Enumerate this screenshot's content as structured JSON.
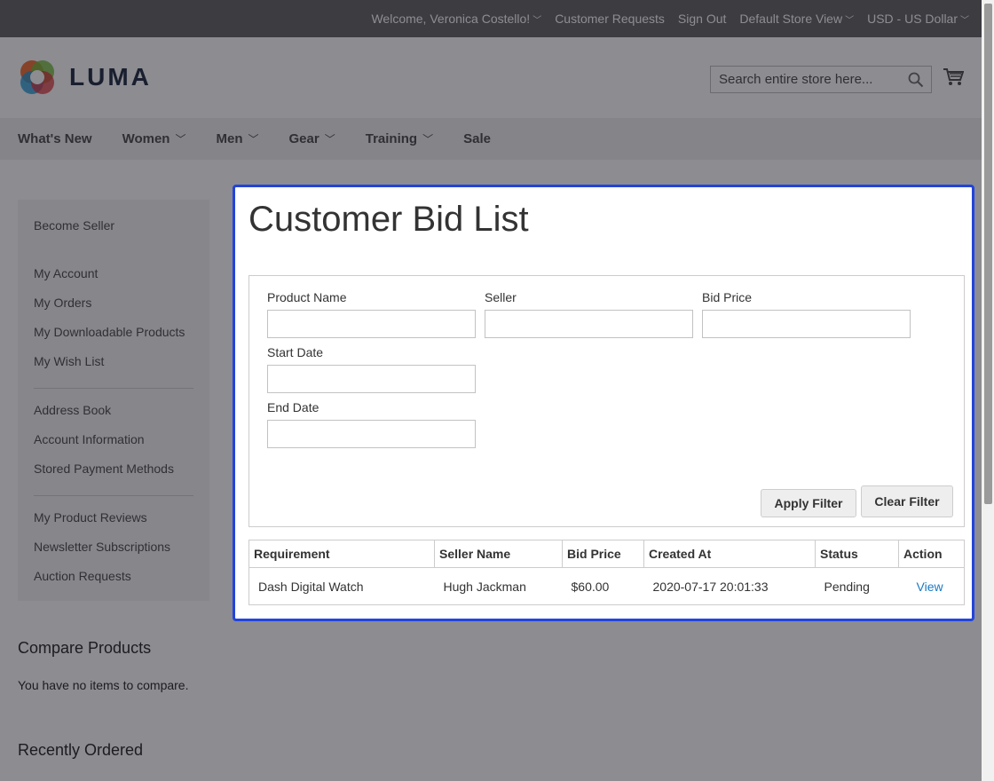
{
  "topbar": {
    "welcome": "Welcome, Veronica Costello!",
    "customer_requests": "Customer Requests",
    "sign_out": "Sign Out",
    "store_view": "Default Store View",
    "currency": "USD - US Dollar"
  },
  "header": {
    "logo_text": "LUMA",
    "search_placeholder": "Search entire store here..."
  },
  "nav": {
    "items": [
      {
        "label": "What's New",
        "has_dropdown": false
      },
      {
        "label": "Women",
        "has_dropdown": true
      },
      {
        "label": "Men",
        "has_dropdown": true
      },
      {
        "label": "Gear",
        "has_dropdown": true
      },
      {
        "label": "Training",
        "has_dropdown": true
      },
      {
        "label": "Sale",
        "has_dropdown": false
      }
    ]
  },
  "sidebar": {
    "groups": [
      [
        "Become Seller"
      ],
      [
        "My Account",
        "My Orders",
        "My Downloadable Products",
        "My Wish List"
      ],
      [
        "Address Book",
        "Account Information",
        "Stored Payment Methods"
      ],
      [
        "My Product Reviews",
        "Newsletter Subscriptions",
        "Auction Requests"
      ]
    ]
  },
  "compare": {
    "title": "Compare Products",
    "empty_text": "You have no items to compare."
  },
  "recent": {
    "title": "Recently Ordered"
  },
  "main": {
    "title": "Customer Bid List",
    "filters": {
      "product_name_label": "Product Name",
      "product_name_value": "",
      "seller_label": "Seller",
      "seller_value": "",
      "bid_price_label": "Bid Price",
      "bid_price_value": "",
      "start_date_label": "Start Date",
      "start_date_value": "",
      "end_date_label": "End Date",
      "end_date_value": "",
      "apply_label": "Apply Filter",
      "clear_label": "Clear Filter"
    },
    "table": {
      "headers": [
        "Requirement",
        "Seller Name",
        "Bid Price",
        "Created At",
        "Status",
        "Action"
      ],
      "rows": [
        [
          "Dash Digital Watch",
          "Hugh Jackman",
          "$60.00",
          "2020-07-17 20:01:33",
          "Pending",
          "View"
        ]
      ]
    }
  },
  "colors": {
    "highlight_border": "#2244dd",
    "link": "#1979c3",
    "topbar": "#6e6e6e"
  }
}
